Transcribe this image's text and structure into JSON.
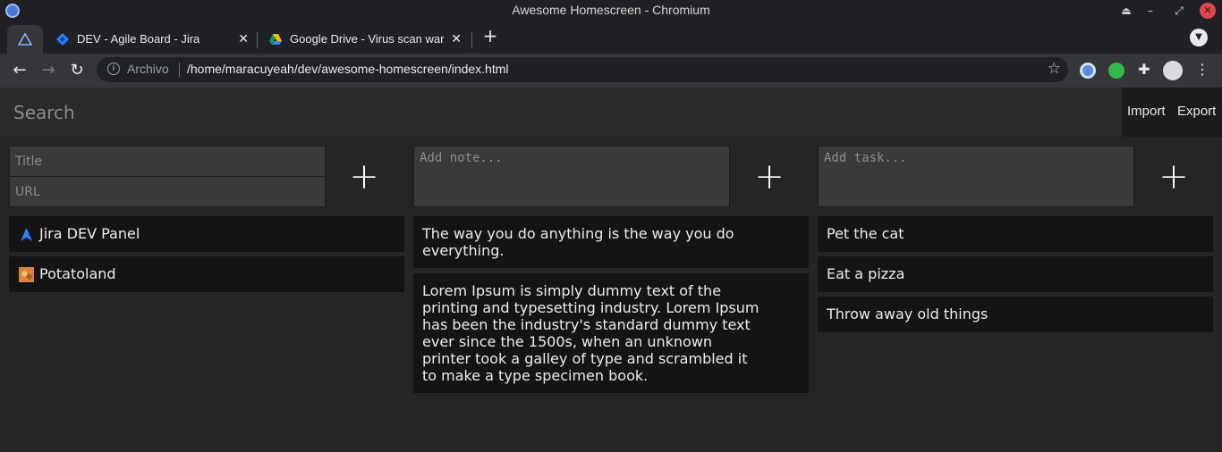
{
  "window": {
    "title": "Awesome Homescreen - Chromium"
  },
  "tabs": [
    {
      "label": ""
    },
    {
      "label": "DEV - Agile Board - Jira"
    },
    {
      "label": "Google Drive - Virus scan warn"
    }
  ],
  "toolbar": {
    "scheme_label": "Archivo",
    "url": "/home/maracuyeah/dev/awesome-homescreen/index.html"
  },
  "app": {
    "search_placeholder": "Search",
    "import_label": "Import",
    "export_label": "Export",
    "bookmarks": {
      "title_placeholder": "Title",
      "url_placeholder": "URL",
      "add_label": "+",
      "items": [
        {
          "label": "Jira DEV Panel",
          "icon": "jira-icon"
        },
        {
          "label": "Potatoland",
          "icon": "potato-icon"
        }
      ]
    },
    "notes": {
      "placeholder": "Add note...",
      "add_label": "+",
      "items": [
        {
          "text": "The way you do anything is the way you do everything."
        },
        {
          "text": "Lorem Ipsum is simply dummy text of the printing and typesetting industry. Lorem Ipsum has been the industry's standard dummy text ever since the 1500s, when an unknown printer took a galley of type and scrambled it to make a type specimen book."
        }
      ]
    },
    "tasks": {
      "placeholder": "Add task...",
      "add_label": "+",
      "items": [
        {
          "text": "Pet the cat"
        },
        {
          "text": "Eat a pizza"
        },
        {
          "text": "Throw away old things"
        }
      ]
    }
  }
}
